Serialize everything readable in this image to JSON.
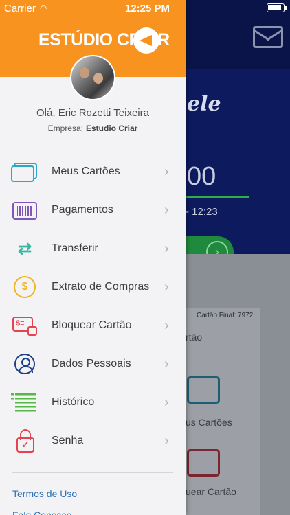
{
  "status_bar": {
    "carrier": "Carrier",
    "wifi_icon": "wifi-icon",
    "time": "12:25 PM",
    "battery_icon": "battery-icon"
  },
  "background_app": {
    "brand_fragment": "ele",
    "balance_fragment": "00",
    "time_fragment": "- 12:23",
    "card_final": "Cartão Final: 7972",
    "cartao_fragment": "rtão",
    "cards_fragment": "us Cartões",
    "lock_fragment": "uear Cartão"
  },
  "drawer": {
    "logo_text": "ESTÚDIO CRIAR",
    "greeting": "Olá, Eric Rozetti Teixeira",
    "company_label": "Empresa:",
    "company_name": "Estudio Criar",
    "menu": [
      {
        "label": "Meus Cartões",
        "icon": "cards-icon"
      },
      {
        "label": "Pagamentos",
        "icon": "barcode-icon"
      },
      {
        "label": "Transferir",
        "icon": "transfer-icon"
      },
      {
        "label": "Extrato de Compras",
        "icon": "coin-statement-icon"
      },
      {
        "label": "Bloquear Cartão",
        "icon": "card-lock-icon"
      },
      {
        "label": "Dados Pessoais",
        "icon": "user-edit-icon"
      },
      {
        "label": "Histórico",
        "icon": "list-icon"
      },
      {
        "label": "Senha",
        "icon": "padlock-icon"
      }
    ],
    "footer_links": [
      "Termos de Uso",
      "Fale Conosco"
    ]
  },
  "colors": {
    "header_orange": "#f7931e",
    "drawer_bg": "#f3f3f5",
    "link_blue": "#2f73b6"
  }
}
